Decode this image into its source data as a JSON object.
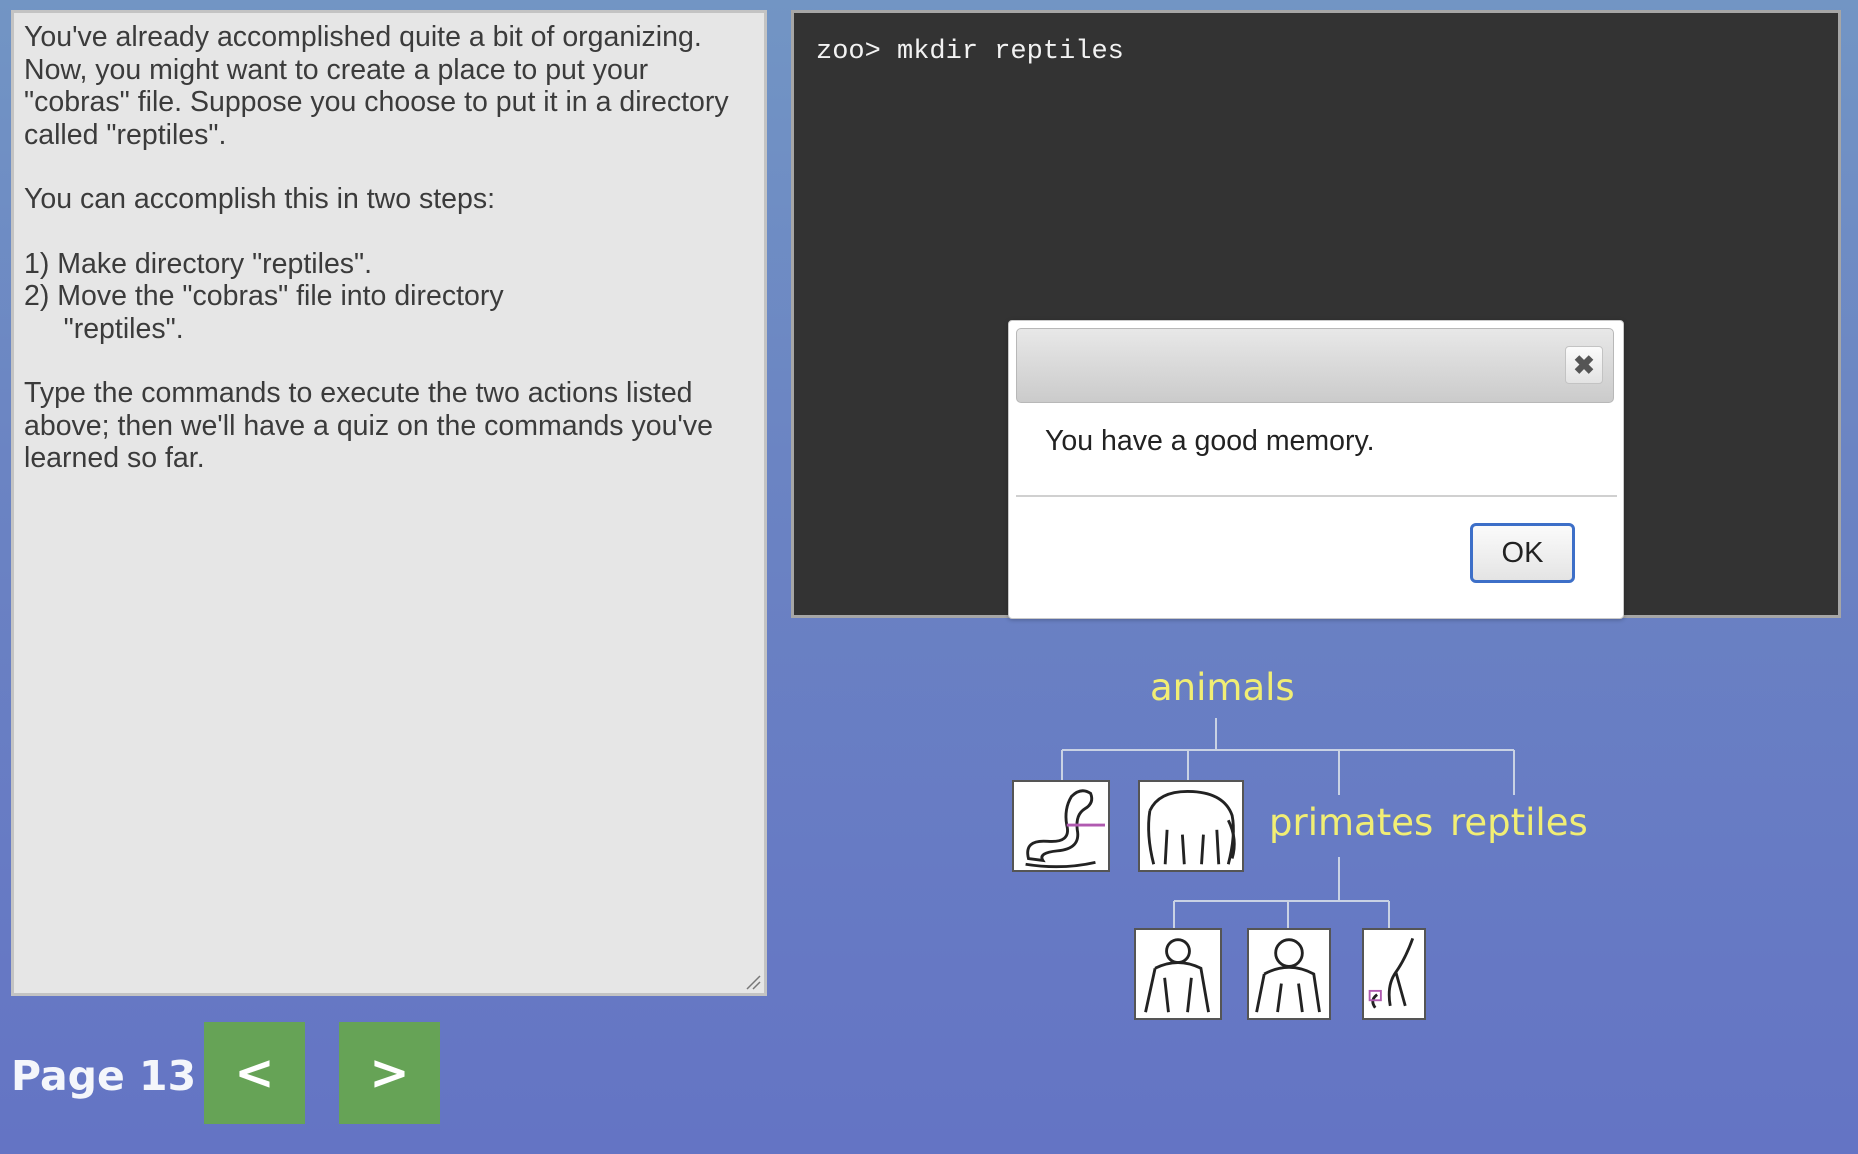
{
  "lesson": {
    "paragraphs": [
      "You've already accomplished quite a bit of organizing.\nNow, you might want to create a place to put your\n\"cobras\" file. Suppose you choose to put it in a directory\ncalled \"reptiles\".",
      "You can accomplish this in two steps:",
      "1) Make directory \"reptiles\".\n2) Move the \"cobras\" file into directory\n     \"reptiles\".",
      "Type the commands to execute the two actions listed\nabove; then we'll have a quiz on the commands you've\nlearned so far."
    ]
  },
  "nav": {
    "page_label": "Page 13",
    "prev_label": "<",
    "next_label": ">"
  },
  "terminal": {
    "line": "zoo> mkdir reptiles"
  },
  "dialog": {
    "close_glyph": "✖",
    "message": "You have a good memory.",
    "ok_label": "OK"
  },
  "tree": {
    "root": "animals",
    "dirs": [
      "primates",
      "reptiles"
    ],
    "files": [
      {
        "icon": "cobra-icon"
      },
      {
        "icon": "elephant-icon"
      }
    ],
    "primate_files": [
      {
        "icon": "gorilla-icon"
      },
      {
        "icon": "ape-icon"
      },
      {
        "icon": "monkey-icon"
      }
    ]
  },
  "colors": {
    "tree_label": "#f1ee74",
    "nav_button": "#66a356",
    "terminal_bg": "#333333"
  }
}
